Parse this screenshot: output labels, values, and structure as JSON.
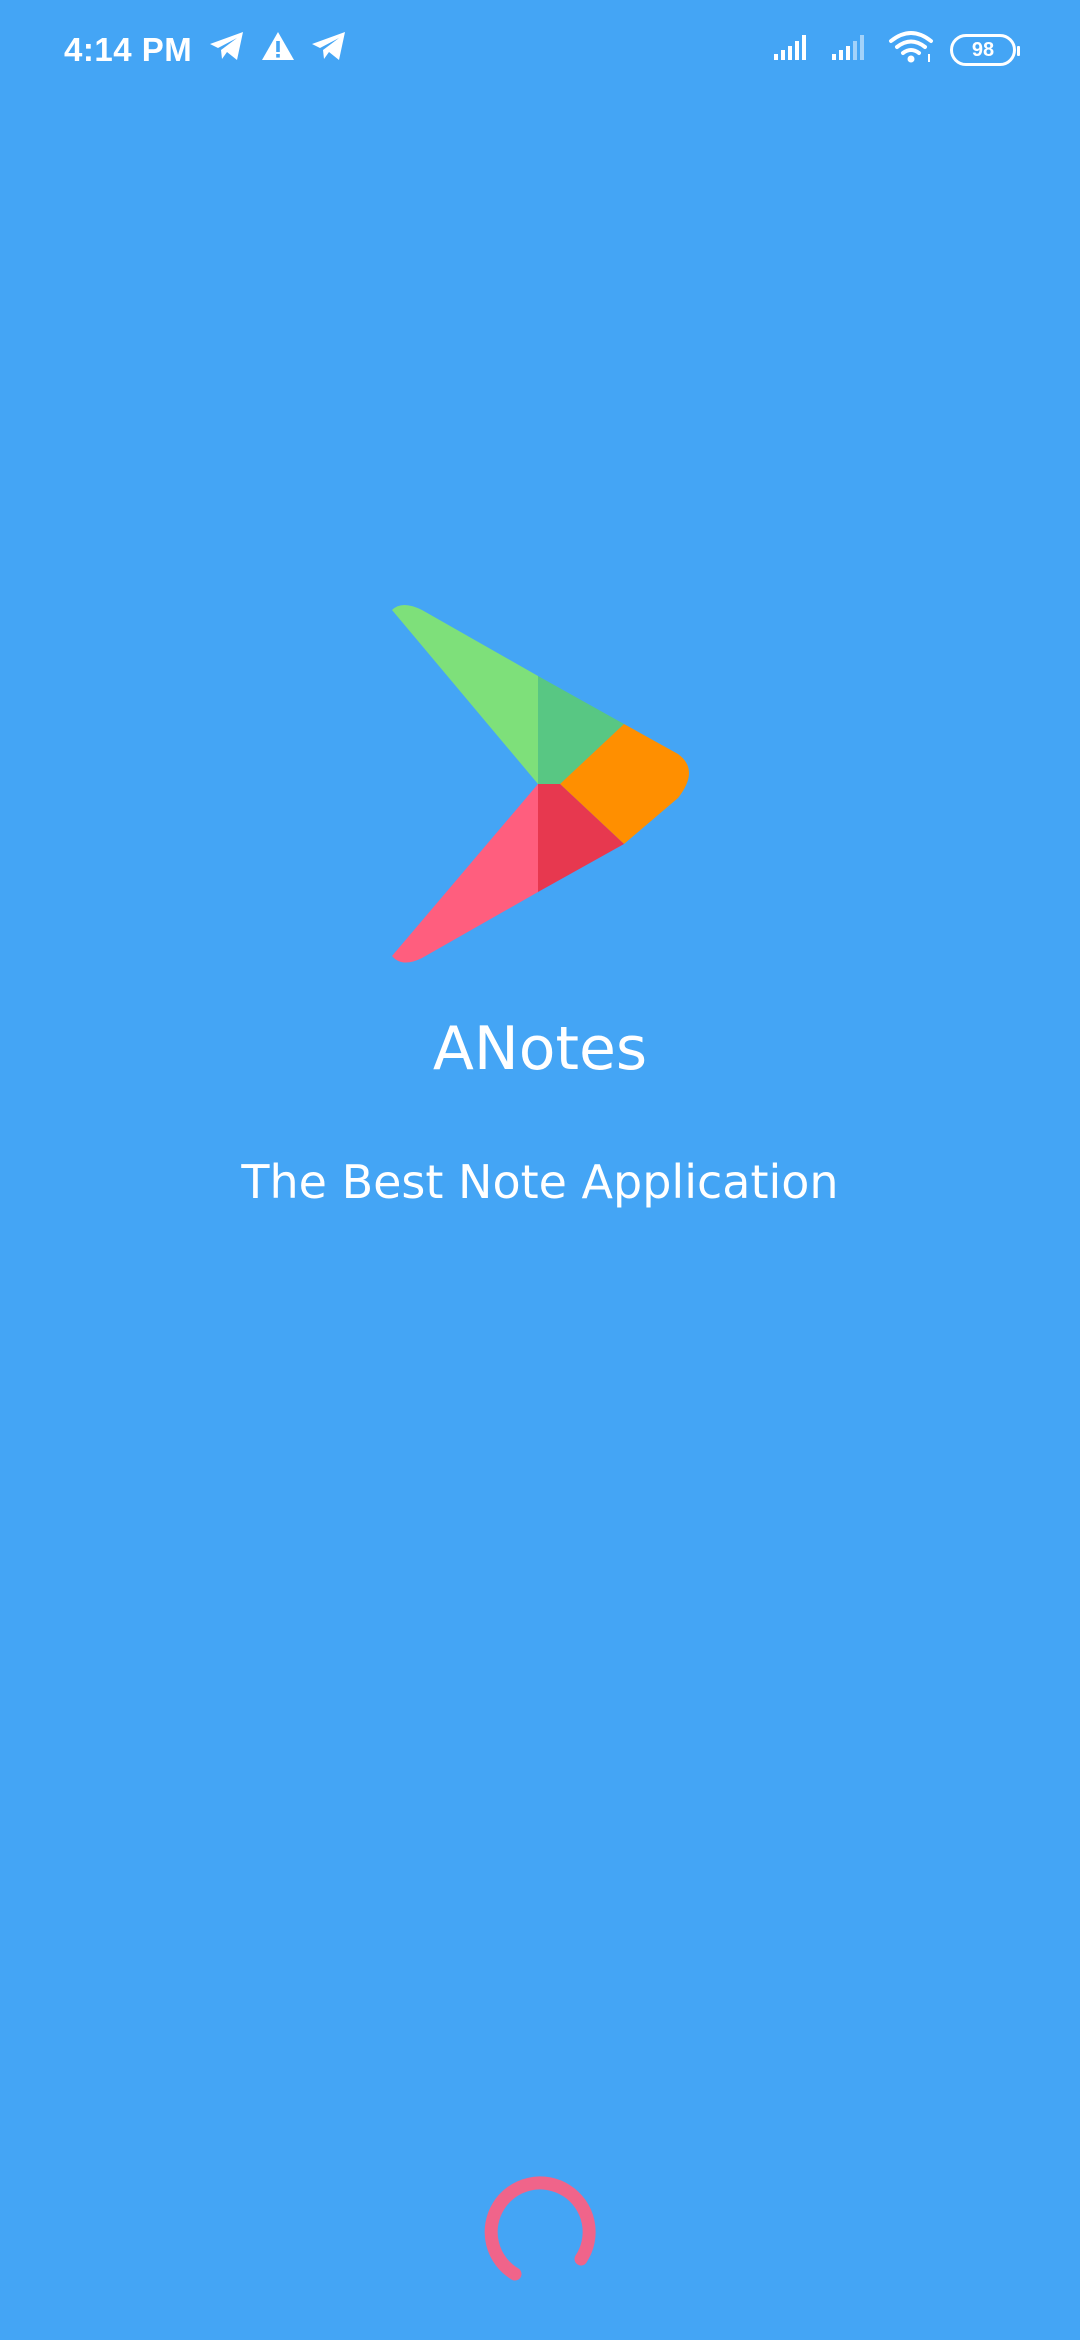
{
  "status_bar": {
    "time": "4:14 PM",
    "left_icons": [
      "telegram-icon",
      "warning-icon",
      "telegram-icon"
    ],
    "right_icons": [
      "signal-icon",
      "signal-icon",
      "wifi-icon",
      "battery-icon"
    ],
    "battery_level": "98"
  },
  "splash": {
    "logo_icon": "play-triangle-logo-icon",
    "app_name": "ANotes",
    "tagline": "The Best Note Application",
    "logo_colors": {
      "green": "#7EE07A",
      "green_dark": "#58C783",
      "orange": "#FF8F00",
      "pink": "#FF5E7E",
      "red": "#E7384F"
    },
    "spinner_color": "#F0648A"
  },
  "theme": {
    "background": "#44A5F5",
    "text": "#FFFFFF"
  }
}
